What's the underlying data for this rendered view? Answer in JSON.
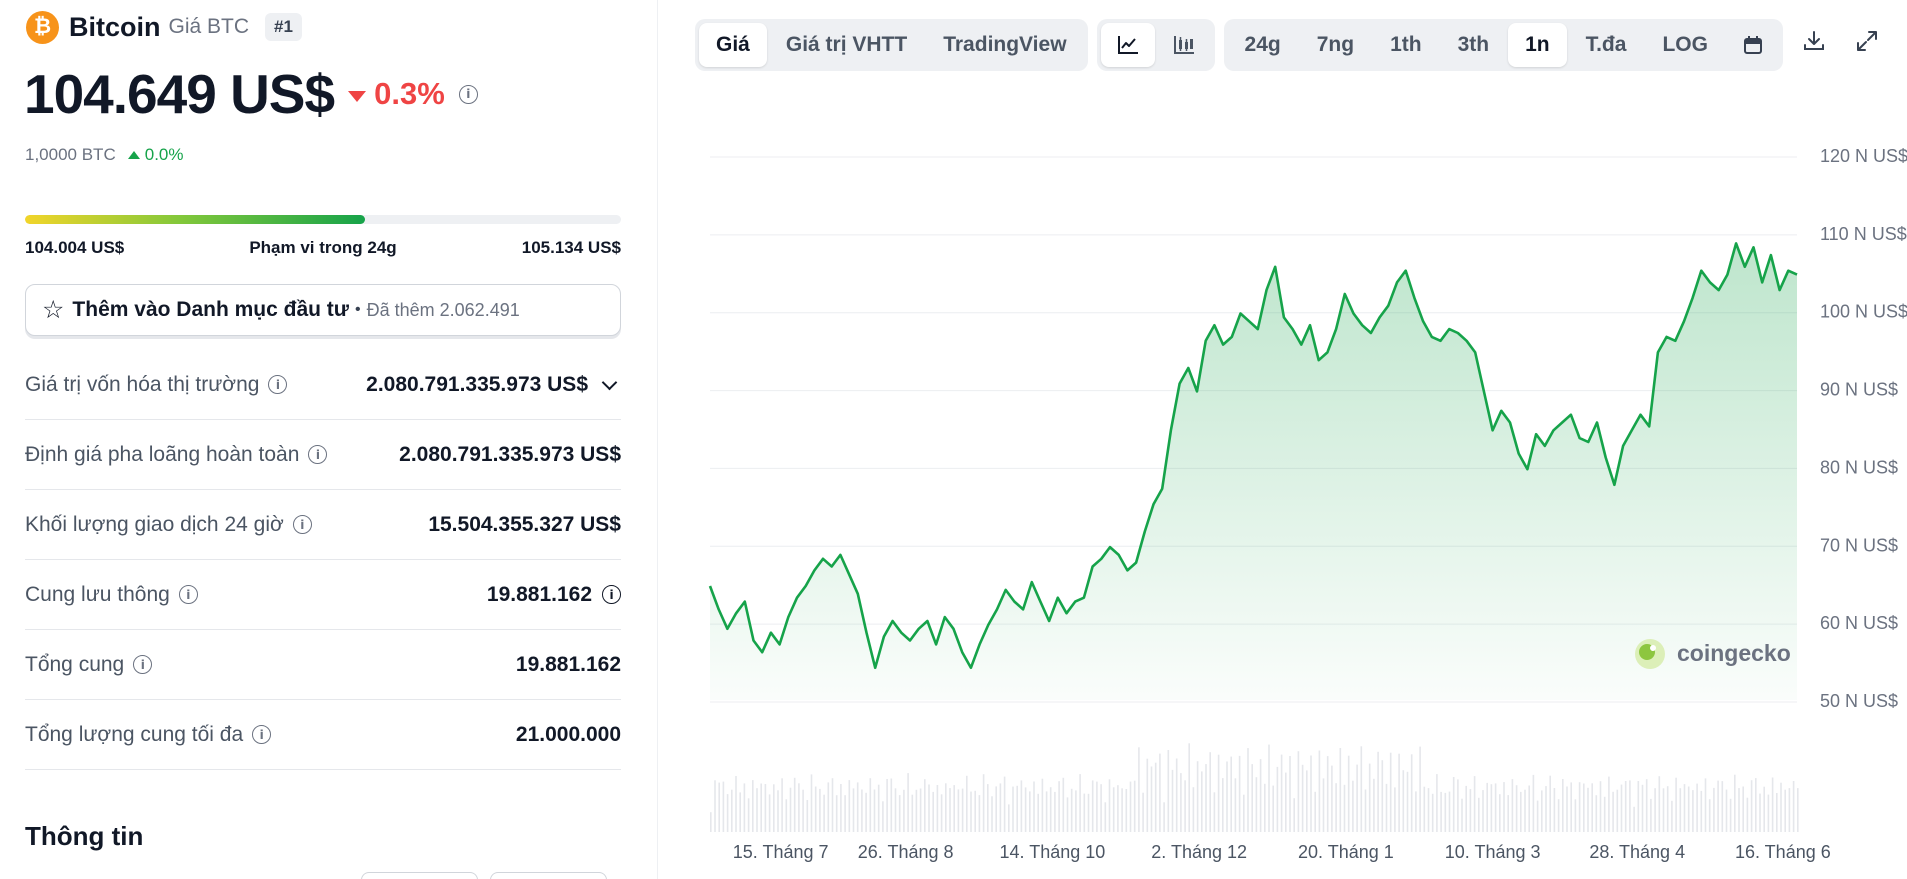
{
  "coin": {
    "logo_symbol": "₿",
    "name": "Bitcoin",
    "subtitle": "Giá BTC",
    "rank": "#1",
    "price": "104.649 US$",
    "change_pct": "0.3%",
    "btc_value": "1,0000 BTC",
    "btc_change": "0.0%"
  },
  "range_24h": {
    "low": "104.004 US$",
    "label": "Phạm vi trong 24g",
    "high": "105.134 US$",
    "position_fraction": 0.57
  },
  "watchlist": {
    "label": "Thêm vào Danh mục đầu tư",
    "separator": "•",
    "added": "Đã thêm 2.062.491"
  },
  "stats": [
    {
      "label": "Giá trị vốn hóa thị trường",
      "value": "2.080.791.335.973 US$"
    },
    {
      "label": "Định giá pha loãng hoàn toàn",
      "value": "2.080.791.335.973 US$"
    },
    {
      "label": "Khối lượng giao dịch 24 giờ",
      "value": "15.504.355.327 US$"
    },
    {
      "label": "Cung lưu thông",
      "value": "19.881.162"
    },
    {
      "label": "Tổng cung",
      "value": "19.881.162"
    },
    {
      "label": "Tổng lượng cung tối đa",
      "value": "21.000.000"
    }
  ],
  "info_heading": "Thông tin",
  "toolbar": {
    "view_tabs": [
      "Giá",
      "Giá trị VHTT",
      "TradingView"
    ],
    "active_view": "Giá",
    "chart_type_icons": [
      "line-chart-icon",
      "candlestick-icon"
    ],
    "ranges": [
      "24g",
      "7ng",
      "1th",
      "3th",
      "1n",
      "T.đa",
      "LOG"
    ],
    "active_range": "1n",
    "tool_icons": [
      "calendar-icon",
      "download-icon",
      "expand-icon"
    ]
  },
  "watermark": "coingecko",
  "colors": {
    "up": "#16a34a",
    "down": "#ef4444",
    "line": "#16a34a",
    "btc_orange": "#f7931a"
  },
  "chart_data": {
    "type": "area",
    "y_tick_labels": [
      "120 N US$",
      "110 N US$",
      "100 N US$",
      "90 N US$",
      "80 N US$",
      "70 N US$",
      "60 N US$",
      "50 N US$"
    ],
    "y_ticks": [
      120000,
      110000,
      100000,
      90000,
      80000,
      70000,
      60000,
      50000
    ],
    "ylim": [
      50000,
      120000
    ],
    "x_tick_labels": [
      "15. Tháng 7",
      "26. Tháng 8",
      "14. Tháng 10",
      "2. Tháng 12",
      "20. Tháng 1",
      "10. Tháng 3",
      "28. Tháng 4",
      "16. Tháng 6"
    ],
    "x_tick_positions": [
      0.065,
      0.18,
      0.315,
      0.45,
      0.585,
      0.72,
      0.853,
      0.987
    ],
    "series": [
      {
        "values": [
          64000,
          61000,
          58500,
          60500,
          62000,
          57000,
          55500,
          58000,
          56500,
          60000,
          62500,
          64000,
          66000,
          67500,
          66500,
          68000,
          65500,
          63000,
          58000,
          53500,
          57500,
          59500,
          58000,
          57000,
          58500,
          59500,
          56500,
          60000,
          58500,
          55500,
          53500,
          56500,
          59000,
          61000,
          63500,
          62000,
          61000,
          64500,
          62000,
          59500,
          62500,
          60500,
          62000,
          62500,
          66500,
          67500,
          69000,
          68000,
          66000,
          67000,
          71000,
          74500,
          76500,
          84000,
          90000,
          92000,
          89000,
          95500,
          97500,
          95000,
          96000,
          99000,
          98000,
          97000,
          102000,
          105000,
          98500,
          97000,
          95000,
          97500,
          93000,
          94000,
          97000,
          101500,
          99000,
          97500,
          96500,
          98500,
          100000,
          103000,
          104500,
          101000,
          98000,
          96000,
          95500,
          97000,
          96500,
          95500,
          94000,
          89000,
          84000,
          86500,
          85000,
          81000,
          79000,
          83500,
          82000,
          84000,
          85000,
          86000,
          83000,
          82500,
          85000,
          80500,
          77000,
          82000,
          84000,
          86000,
          84500,
          94000,
          96000,
          95500,
          98000,
          101000,
          104500,
          103000,
          102000,
          104000,
          108000,
          105000,
          107500,
          103000,
          106500,
          102000,
          104500,
          104000
        ]
      }
    ],
    "volume_note": "bottom volume bars shown without scale"
  }
}
